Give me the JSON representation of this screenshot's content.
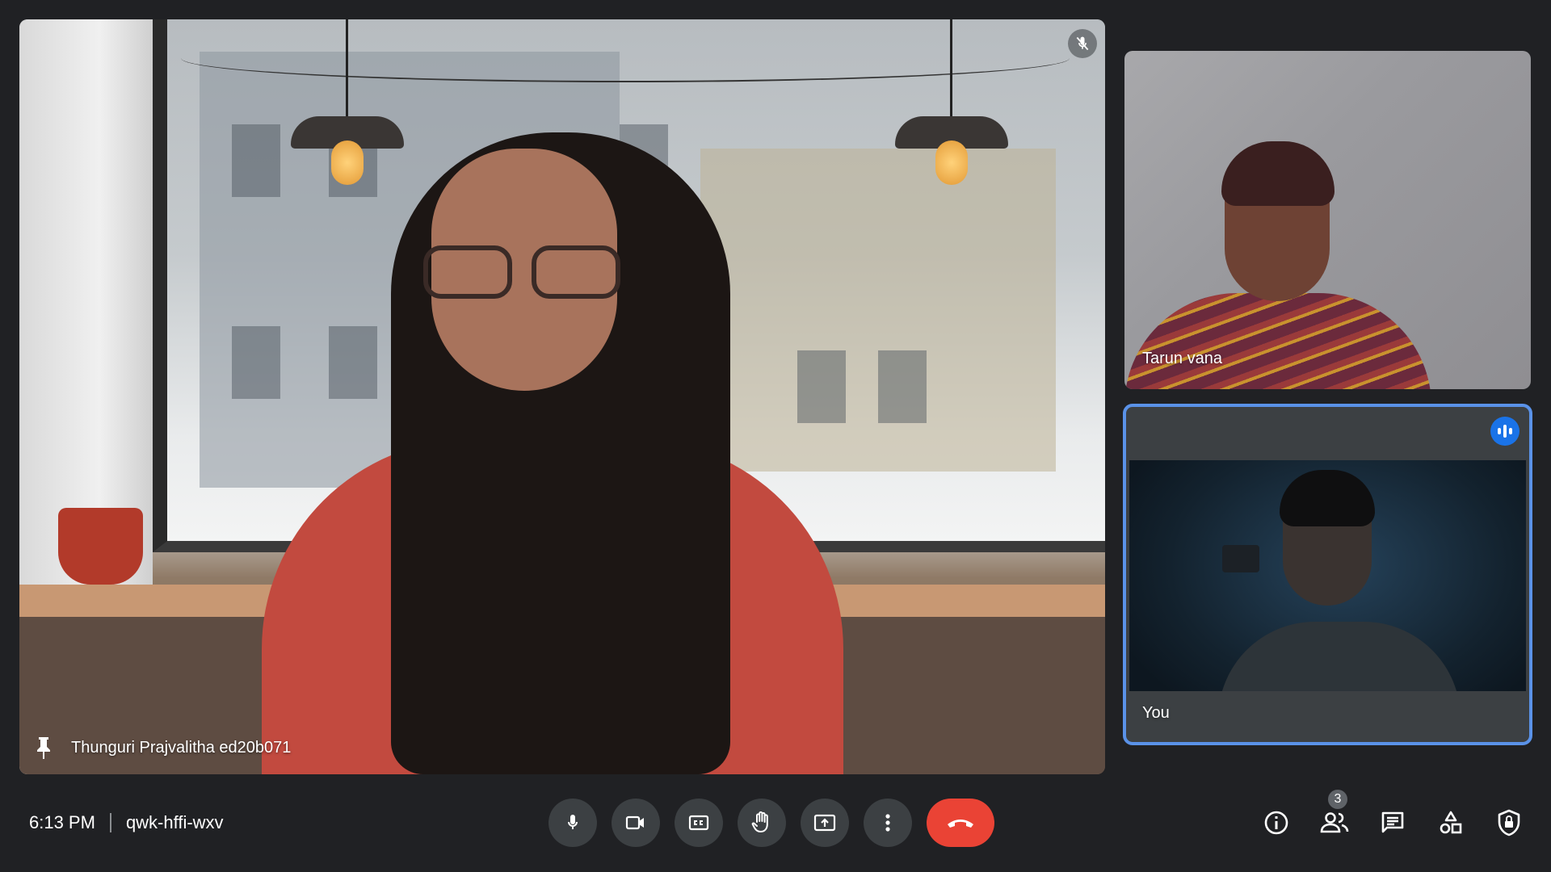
{
  "meeting": {
    "time": "6:13 PM",
    "code": "qwk-hffi-wxv"
  },
  "main_participant": {
    "name": "Thunguri Prajvalitha ed20b071",
    "muted": true,
    "pinned": true
  },
  "side_participants": [
    {
      "name": "Tarun vana"
    },
    {
      "name": "You",
      "speaking": true
    }
  ],
  "controls": [
    {
      "icon": "mic-icon",
      "label": "Turn off microphone"
    },
    {
      "icon": "camera-icon",
      "label": "Turn off camera"
    },
    {
      "icon": "captions-icon",
      "label": "Turn on captions"
    },
    {
      "icon": "raise-hand-icon",
      "label": "Raise hand"
    },
    {
      "icon": "present-icon",
      "label": "Present now"
    },
    {
      "icon": "more-options-icon",
      "label": "More options"
    },
    {
      "icon": "end-call-icon",
      "label": "Leave call"
    }
  ],
  "right_panel": {
    "people_count": "3",
    "icons": [
      "info-icon",
      "people-icon",
      "chat-icon",
      "activities-icon",
      "host-controls-icon"
    ]
  },
  "colors": {
    "background": "#202124",
    "control": "#3c4043",
    "end_call": "#ea4335",
    "speaking_accent": "#1a73e8",
    "active_outline": "#5a92e8"
  }
}
